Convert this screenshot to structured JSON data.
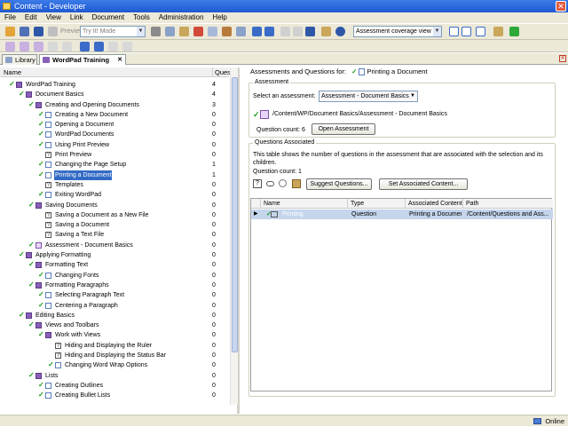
{
  "window": {
    "title": "Content - Developer"
  },
  "menu": [
    "File",
    "Edit",
    "View",
    "Link",
    "Document",
    "Tools",
    "Administration",
    "Help"
  ],
  "toolbar": {
    "preview_label": "Preview",
    "mode_value": "Try It! Mode",
    "view_value": "Assessment coverage view"
  },
  "tabs": [
    {
      "label": "Library",
      "active": false
    },
    {
      "label": "WordPad Training",
      "active": true
    }
  ],
  "tree": {
    "col_name": "Name",
    "col_count": "Quest",
    "rows": [
      {
        "label": "WordPad Training",
        "count": "4",
        "indent": 0,
        "icon": "book",
        "checked": true
      },
      {
        "label": "Document Basics",
        "count": "4",
        "indent": 1,
        "icon": "book",
        "checked": true
      },
      {
        "label": "Creating and Opening Documents",
        "count": "3",
        "indent": 2,
        "icon": "book",
        "checked": true
      },
      {
        "label": "Creating a New Document",
        "count": "0",
        "indent": 3,
        "icon": "page",
        "checked": true
      },
      {
        "label": "Opening a Document",
        "count": "0",
        "indent": 3,
        "icon": "page",
        "checked": true
      },
      {
        "label": "WordPad Documents",
        "count": "0",
        "indent": 3,
        "icon": "page",
        "checked": true
      },
      {
        "label": "Using Print Preview",
        "count": "0",
        "indent": 3,
        "icon": "page",
        "checked": true
      },
      {
        "label": "Print Preview",
        "count": "0",
        "indent": 3,
        "icon": "question",
        "checked": false
      },
      {
        "label": "Changing the Page Setup",
        "count": "1",
        "indent": 3,
        "icon": "page",
        "checked": true
      },
      {
        "label": "Printing a Document",
        "count": "1",
        "indent": 3,
        "icon": "page",
        "checked": true,
        "selected": true
      },
      {
        "label": "Templates",
        "count": "0",
        "indent": 3,
        "icon": "question",
        "checked": false
      },
      {
        "label": "Exiting WordPad",
        "count": "0",
        "indent": 3,
        "icon": "page",
        "checked": true
      },
      {
        "label": "Saving Documents",
        "count": "0",
        "indent": 2,
        "icon": "book",
        "checked": true
      },
      {
        "label": "Saving a Document as a New File",
        "count": "0",
        "indent": 3,
        "icon": "question",
        "checked": false
      },
      {
        "label": "Saving a Document",
        "count": "0",
        "indent": 3,
        "icon": "question",
        "checked": false
      },
      {
        "label": "Saving a Text File",
        "count": "0",
        "indent": 3,
        "icon": "question",
        "checked": false
      },
      {
        "label": "Assessment - Document Basics",
        "count": "0",
        "indent": 2,
        "icon": "assessment",
        "checked": true
      },
      {
        "label": "Applying Formatting",
        "count": "0",
        "indent": 1,
        "icon": "book",
        "checked": true
      },
      {
        "label": "Formatting Text",
        "count": "0",
        "indent": 2,
        "icon": "book",
        "checked": true
      },
      {
        "label": "Changing Fonts",
        "count": "0",
        "indent": 3,
        "icon": "page",
        "checked": true
      },
      {
        "label": "Formatting Paragraphs",
        "count": "0",
        "indent": 2,
        "icon": "book",
        "checked": true
      },
      {
        "label": "Selecting Paragraph Text",
        "count": "0",
        "indent": 3,
        "icon": "page",
        "checked": true
      },
      {
        "label": "Centering a Paragraph",
        "count": "0",
        "indent": 3,
        "icon": "page",
        "checked": true
      },
      {
        "label": "Editing Basics",
        "count": "0",
        "indent": 1,
        "icon": "book",
        "checked": true
      },
      {
        "label": "Views and Toolbars",
        "count": "0",
        "indent": 2,
        "icon": "book",
        "checked": true
      },
      {
        "label": "Work with Views",
        "count": "0",
        "indent": 3,
        "icon": "book",
        "checked": true
      },
      {
        "label": "Hiding and Displaying the Ruler",
        "count": "0",
        "indent": 4,
        "icon": "question",
        "checked": false
      },
      {
        "label": "Hiding and Displaying the Status Bar",
        "count": "0",
        "indent": 4,
        "icon": "question",
        "checked": false
      },
      {
        "label": "Changing Word Wrap Options",
        "count": "0",
        "indent": 4,
        "icon": "page",
        "checked": true
      },
      {
        "label": "Lists",
        "count": "0",
        "indent": 2,
        "icon": "book",
        "checked": true
      },
      {
        "label": "Creating Outlines",
        "count": "0",
        "indent": 3,
        "icon": "page",
        "checked": true
      },
      {
        "label": "Creating Bullet Lists",
        "count": "0",
        "indent": 3,
        "icon": "page",
        "checked": true
      }
    ]
  },
  "right": {
    "heading": "Assessments and Questions for:",
    "heading_target": "Printing a Document",
    "assessment": {
      "group_title": "Assessment",
      "select_label": "Select an assessment:",
      "select_value": "Assessment - Document Basics",
      "path": "/Content/WP/Document Basics/Assessment - Document Basics",
      "question_count": "Question count: 6",
      "open_button": "Open Assessment"
    },
    "questions": {
      "group_title": "Questions Associated",
      "description": "This table shows the number of questions in the assessment that are associated with the selection and its children.",
      "question_count": "Question count: 1",
      "suggest_button": "Suggest Questions...",
      "set_button": "Set Associated Content..."
    },
    "grid": {
      "columns": [
        "Name",
        "Type",
        "Associated Content",
        "Path"
      ],
      "rows": [
        {
          "name": "Printing",
          "type": "Question",
          "content": "Printing a Document",
          "path": "/Content/Questions and Ass..."
        }
      ]
    }
  },
  "status": {
    "text": "Online"
  },
  "colors": {
    "accent": "#316ac5",
    "check": "#1a9b1a"
  }
}
